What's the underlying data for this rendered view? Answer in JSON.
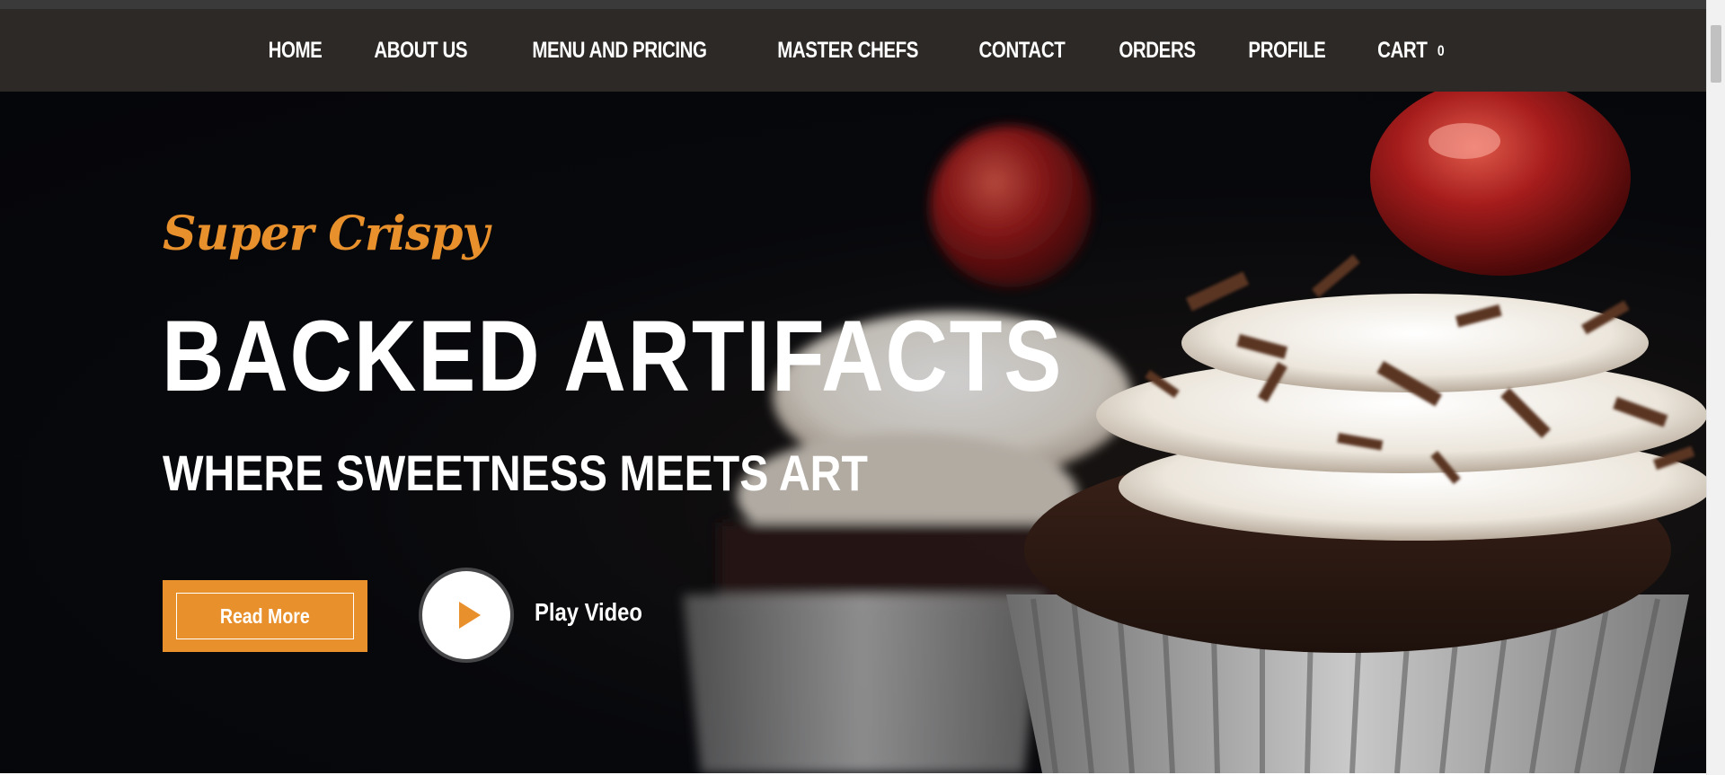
{
  "nav": {
    "items": [
      {
        "label": "HOME"
      },
      {
        "label": "ABOUT US"
      },
      {
        "label": "MENU AND PRICING"
      },
      {
        "label": "MASTER CHEFS"
      },
      {
        "label": "CONTACT"
      },
      {
        "label": "ORDERS"
      },
      {
        "label": "PROFILE"
      }
    ],
    "cart": {
      "label": "CART",
      "count": "0"
    }
  },
  "hero": {
    "tagline": "Super Crispy",
    "headline": "BACKED ARTIFACTS",
    "subheadline": "WHERE SWEETNESS MEETS ART",
    "read_more_label": "Read More",
    "play_video_label": "Play Video",
    "background_image": "cupcakes-with-cherries-and-chocolate-shavings"
  },
  "colors": {
    "accent": "#e8902b",
    "navbar": "#2d2926",
    "hero_dark": "#07080c",
    "text": "#ffffff"
  },
  "icons": {
    "play": "play-icon",
    "scroll": "scrollbar-thumb"
  }
}
